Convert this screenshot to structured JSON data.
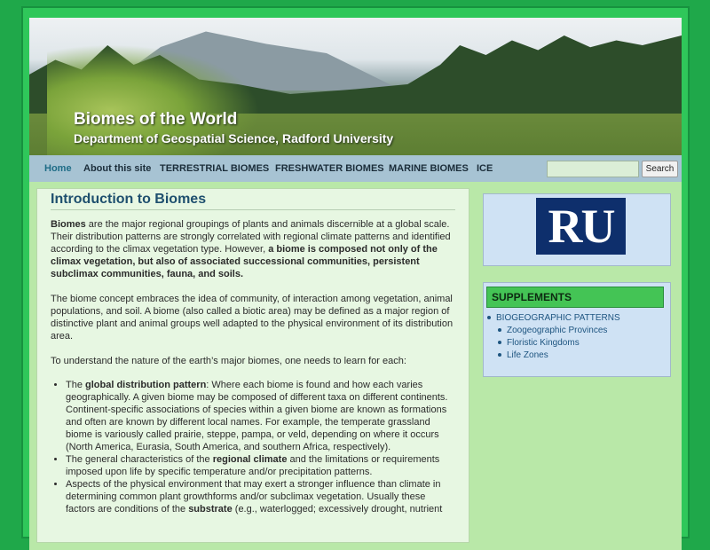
{
  "site": {
    "title": "Biomes of the World",
    "subtitle": "Department of Geospatial Science, Radford University"
  },
  "nav": {
    "items": [
      {
        "label": "Home",
        "active": true
      },
      {
        "label": "About this site",
        "active": false
      },
      {
        "label": "TERRESTRIAL BIOMES",
        "active": false
      },
      {
        "label": "FRESHWATER BIOMES",
        "active": false
      },
      {
        "label": "MARINE BIOMES",
        "active": false
      },
      {
        "label": "ICE",
        "active": false
      }
    ],
    "search_value": "",
    "search_button": "Search"
  },
  "main": {
    "heading": "Introduction to Biomes",
    "p1": {
      "bold_lead": "Biomes",
      "text": " are the major regional groupings of plants and animals discernible at a global scale. Their distribution patterns are strongly correlated with regional climate patterns and identified according to the climax vegetation type. However, ",
      "bold_tail": "a biome is composed not only of the climax vegetation, but also of associated successional communities, persistent subclimax communities, fauna, and soils."
    },
    "p2": "The biome concept embraces the idea of community, of interaction among vegetation, animal populations, and soil. A biome (also called a biotic area) may be defined as a major region of distinctive plant and animal groups well adapted to the physical environment of its distribution area.",
    "p3": "To understand the nature of the earth’s major biomes, one needs to learn for each:",
    "list": [
      {
        "pre": "The ",
        "bold": "global distribution pattern",
        "post": ": Where each biome is found and how each varies geographically. A given biome may be composed of different taxa on different continents. Continent-specific associations of species within a given biome are known as formations and often are known by different local names. For example, the temperate grassland biome is variously called prairie, steppe, pampa, or veld, depending on where it occurs (North America, Eurasia, South America, and southern Africa, respectively)."
      },
      {
        "pre": "The general characteristics of the ",
        "bold": "regional climate",
        "post": " and the limitations or requirements imposed upon life by specific temperature and/or precipitation patterns."
      },
      {
        "pre": "Aspects of the physical environment that may exert a stronger influence than climate in determining common plant growthforms and/or subclimax vegetation. Usually these factors are conditions of the ",
        "bold": "substrate",
        "post": " (e.g., waterlogged; excessively drought, nutrient"
      }
    ]
  },
  "sidebar": {
    "logo_text": "RU",
    "supplements": {
      "heading": "SUPPLEMENTS",
      "items": [
        {
          "label": "BIOGEOGRAPHIC PATTERNS",
          "level": 1
        },
        {
          "label": "Zoogeographic Provinces",
          "level": 2
        },
        {
          "label": "Floristic Kingdoms",
          "level": 2
        },
        {
          "label": "Life Zones",
          "level": 2
        }
      ]
    }
  }
}
